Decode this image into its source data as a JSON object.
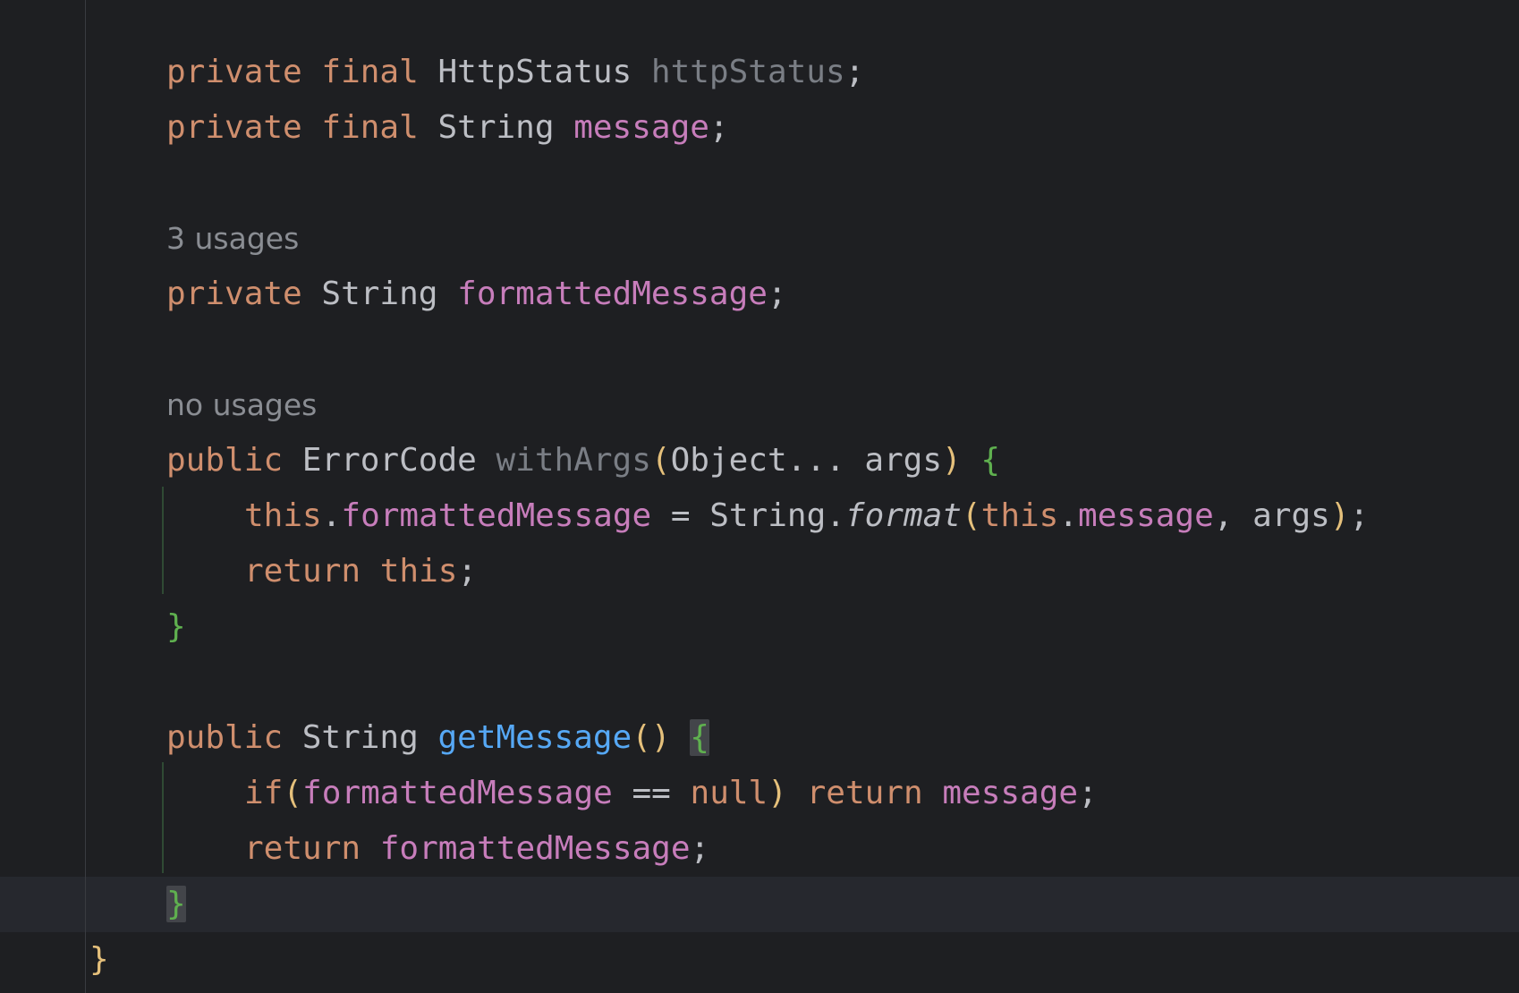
{
  "editor": {
    "lines": [
      {
        "kw1": "private",
        "kw2": "final",
        "type": "HttpStatus",
        "name": "httpStatus",
        "end": ";"
      },
      {
        "kw1": "private",
        "kw2": "final",
        "type": "String",
        "name": "message",
        "end": ";"
      },
      {
        "hint": "3 usages"
      },
      {
        "kw1": "private",
        "type": "String",
        "name": "formattedMessage",
        "end": ";"
      },
      {
        "hint": "no usages"
      },
      {
        "kw1": "public",
        "type": "ErrorCode",
        "method": "withArgs",
        "open_paren": "(",
        "params": "Object... args",
        "close_paren": ")",
        "brace": "{"
      },
      {
        "this1": "this",
        "dot1": ".",
        "field1": "formattedMessage",
        "op": " = String.",
        "call": "format",
        "open_paren": "(",
        "this2": "this",
        "dot2": ".",
        "field2": "message",
        "rest": ", args",
        "close_paren": ")",
        "end": ";"
      },
      {
        "kw1": "return",
        "kw2": "this",
        "end": ";"
      },
      {
        "brace": "}"
      },
      {
        "kw1": "public",
        "type": "String",
        "method": "getMessage",
        "parens": "()",
        "brace": "{"
      },
      {
        "kw1": "if",
        "open_paren": "(",
        "field1": "formattedMessage",
        "op": " == ",
        "kw2": "null",
        "close_paren": ")",
        "kw3": "return",
        "field2": "message",
        "end": ";"
      },
      {
        "kw1": "return",
        "field1": "formattedMessage",
        "end": ";"
      },
      {
        "brace": "}"
      },
      {
        "brace": "}"
      }
    ]
  },
  "colors": {
    "background": "#1e1f22",
    "keyword": "#cf8e6d",
    "field": "#c77dbb",
    "method": "#56a8f5",
    "text": "#bcbec4",
    "hint": "#8a8d93",
    "brace_green": "#5fb04f",
    "brace_yellow": "#e5c07b"
  }
}
